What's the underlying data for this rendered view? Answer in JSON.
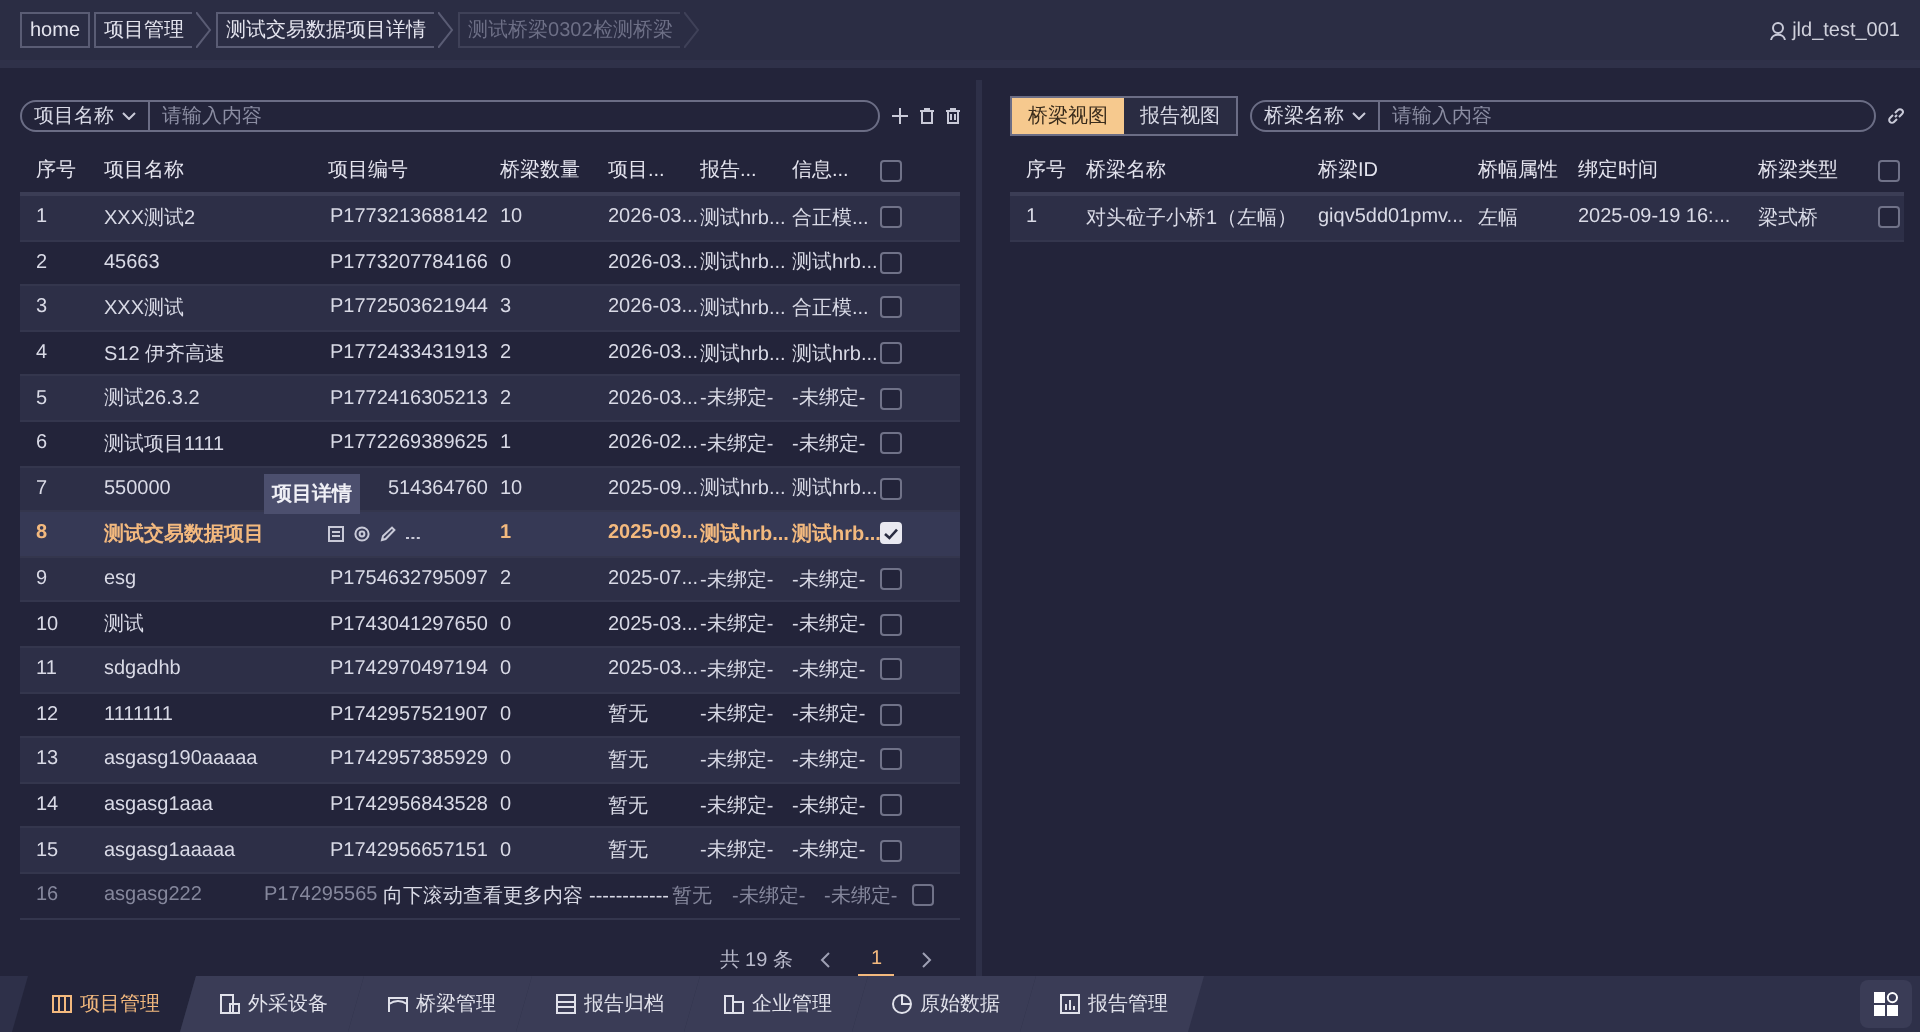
{
  "breadcrumb": [
    {
      "label": "home",
      "kind": "home"
    },
    {
      "label": "项目管理",
      "kind": "link"
    },
    {
      "label": "测试交易数据项目详情",
      "kind": "link"
    },
    {
      "label": "测试桥梁0302检测桥梁",
      "kind": "current"
    }
  ],
  "user": "jld_test_001",
  "project_panel": {
    "filter": {
      "field": "项目名称",
      "placeholder": "请输入内容"
    },
    "columns": [
      "序号",
      "项目名称",
      "项目编号",
      "桥梁数量",
      "项目...",
      "报告...",
      "信息..."
    ],
    "select_all": false,
    "rows": [
      {
        "no": "1",
        "name": "XXX测试2",
        "code": "P1773213688142",
        "bridges": "10",
        "column_5": "2026-03...",
        "column_6": "测试hrb...",
        "column_7": "合正模...",
        "checked": false,
        "selected": false
      },
      {
        "no": "2",
        "name": "45663",
        "code": "P1773207784166",
        "bridges": "0",
        "column_5": "2026-03...",
        "column_6": "测试hrb...",
        "column_7": "测试hrb...",
        "checked": false,
        "selected": false
      },
      {
        "no": "3",
        "name": "XXX测试",
        "code": "P1772503621944",
        "bridges": "3",
        "column_5": "2026-03...",
        "column_6": "测试hrb...",
        "column_7": "合正模...",
        "checked": false,
        "selected": false
      },
      {
        "no": "4",
        "name": "S12 伊齐高速",
        "code": "P1772433431913",
        "bridges": "2",
        "column_5": "2026-03...",
        "column_6": "测试hrb...",
        "column_7": "测试hrb...",
        "checked": false,
        "selected": false
      },
      {
        "no": "5",
        "name": "测试26.3.2",
        "code": "P1772416305213",
        "bridges": "2",
        "column_5": "2026-03...",
        "column_6": "-未绑定-",
        "column_7": "-未绑定-",
        "checked": false,
        "selected": false
      },
      {
        "no": "6",
        "name": "测试项目1111",
        "code": "P1772269389625",
        "bridges": "1",
        "column_5": "2026-02...",
        "column_6": "-未绑定-",
        "column_7": "-未绑定-",
        "checked": false,
        "selected": false
      },
      {
        "no": "7",
        "name": "550000",
        "code": "514364760",
        "bridges": "10",
        "column_5": "2025-09...",
        "column_6": "测试hrb...",
        "column_7": "测试hrb...",
        "checked": false,
        "selected": false
      },
      {
        "no": "8",
        "name": "测试交易数据项目",
        "hovered": true,
        "tooltip": "项目详情",
        "bridges": "1",
        "column_5": "2025-09...",
        "column_6": "测试hrb...",
        "column_7": "测试hrb...",
        "checked": true,
        "selected": true
      },
      {
        "no": "9",
        "name": "esg",
        "code": "P1754632795097",
        "bridges": "2",
        "column_5": "2025-07...",
        "column_6": "-未绑定-",
        "column_7": "-未绑定-",
        "checked": false,
        "selected": false
      },
      {
        "no": "10",
        "name": "测试",
        "code": "P1743041297650",
        "bridges": "0",
        "column_5": "2025-03...",
        "column_6": "-未绑定-",
        "column_7": "-未绑定-",
        "checked": false,
        "selected": false
      },
      {
        "no": "11",
        "name": "sdgadhb",
        "code": "P1742970497194",
        "bridges": "0",
        "column_5": "2025-03...",
        "column_6": "-未绑定-",
        "column_7": "-未绑定-",
        "checked": false,
        "selected": false
      },
      {
        "no": "12",
        "name": "1111111",
        "code": "P1742957521907",
        "bridges": "0",
        "column_5": "暂无",
        "column_6": "-未绑定-",
        "column_7": "-未绑定-",
        "checked": false,
        "selected": false
      },
      {
        "no": "13",
        "name": "asgasg190aaaaa",
        "code": "P1742957385929",
        "bridges": "0",
        "column_5": "暂无",
        "column_6": "-未绑定-",
        "column_7": "-未绑定-",
        "checked": false,
        "selected": false
      },
      {
        "no": "14",
        "name": "asgasg1aaa",
        "code": "P1742956843528",
        "bridges": "0",
        "column_5": "暂无",
        "column_6": "-未绑定-",
        "column_7": "-未绑定-",
        "checked": false,
        "selected": false
      },
      {
        "no": "15",
        "name": "asgasg1aaaaa",
        "code": "P1742956657151",
        "bridges": "0",
        "column_5": "暂无",
        "column_6": "-未绑定-",
        "column_7": "-未绑定-",
        "checked": false,
        "selected": false
      },
      {
        "no": "16",
        "name": "asgasg222",
        "code": "P174295565",
        "column_5": "暂无",
        "column_6": "-未绑定-",
        "column_7": "-未绑定-",
        "checked": false,
        "selected": false,
        "faded": true
      }
    ],
    "scroll_hint": "向下滚动查看更多内容 ------------",
    "pagination": {
      "total": "共 19 条",
      "pages": [
        {
          "label": "1",
          "selected": true
        }
      ]
    }
  },
  "bridge_panel": {
    "view_tabs": [
      {
        "label": "桥梁视图",
        "selected": true
      },
      {
        "label": "报告视图",
        "selected": false
      }
    ],
    "filter": {
      "field": "桥梁名称",
      "placeholder": "请输入内容"
    },
    "columns": [
      "序号",
      "桥梁名称",
      "桥梁ID",
      "桥幅属性",
      "绑定时间",
      "桥梁类型"
    ],
    "select_all": false,
    "rows": [
      {
        "no": "1",
        "name": "对头砬子小桥1（左幅）",
        "id": "giqv5dd01pmv...",
        "side": "左幅",
        "bound_time": "2025-09-19 16:...",
        "type": "梁式桥",
        "checked": false
      }
    ]
  },
  "bottom_nav": [
    {
      "label": "项目管理",
      "kind": "project",
      "selected": true
    },
    {
      "label": "外采设备",
      "kind": "device",
      "selected": false
    },
    {
      "label": "桥梁管理",
      "kind": "bridge",
      "selected": false
    },
    {
      "label": "报告归档",
      "kind": "archive",
      "selected": false
    },
    {
      "label": "企业管理",
      "kind": "company",
      "selected": false
    },
    {
      "label": "原始数据",
      "kind": "data",
      "selected": false
    },
    {
      "label": "报告管理",
      "kind": "report",
      "selected": false
    }
  ]
}
